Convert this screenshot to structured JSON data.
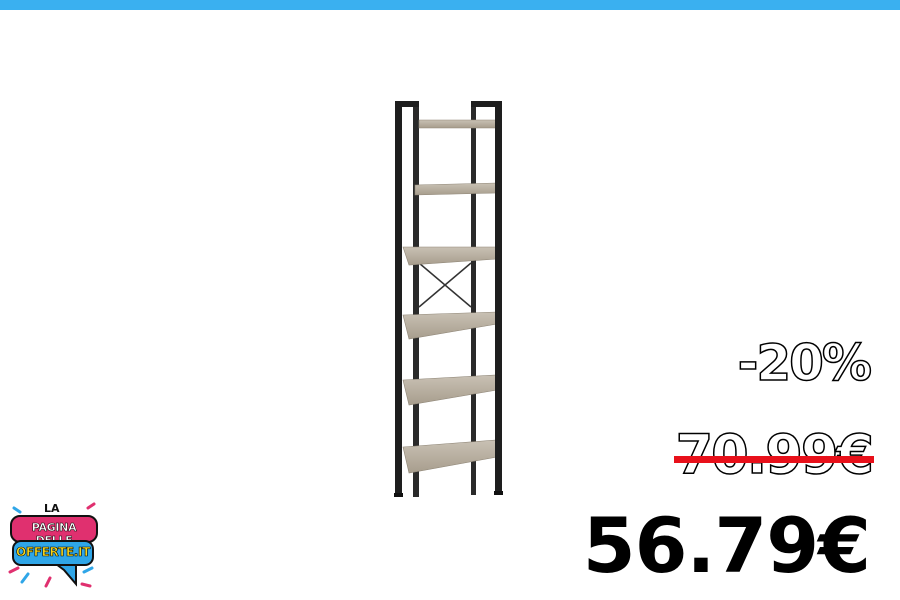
{
  "colors": {
    "top_bar": "#3ab0f0",
    "strike": "#e8101a",
    "logo_pink": "#e0306f",
    "logo_blue": "#2fa6e8",
    "logo_yellow": "#f9d71c"
  },
  "product": {
    "icon": "bookshelf-image"
  },
  "offer": {
    "discount": "-20%",
    "old_price": "70.99€",
    "new_price": "56.79€"
  },
  "logo": {
    "small": "LA",
    "line1": "PAGINA DELLE",
    "line2": "OFFERTE.IT"
  }
}
